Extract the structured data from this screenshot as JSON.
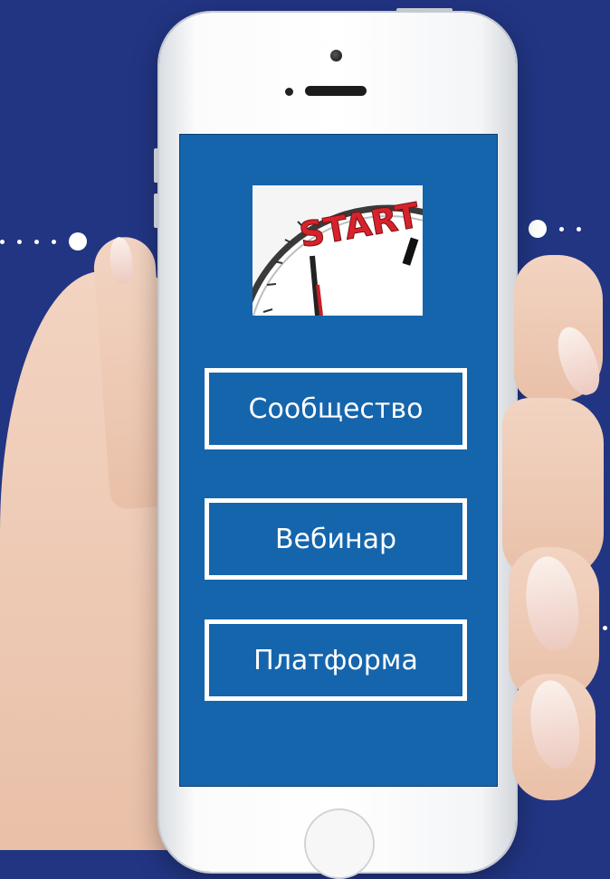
{
  "screen": {
    "image": {
      "alt_text": "START",
      "icon": "start-stopwatch"
    },
    "buttons": [
      {
        "label": "Сообщество"
      },
      {
        "label": "Вебинар"
      },
      {
        "label": "Платформа"
      }
    ]
  },
  "colors": {
    "background": "#223583",
    "screen": "#1565ac",
    "button_border": "#ffffff",
    "start_text": "#d6232b"
  }
}
